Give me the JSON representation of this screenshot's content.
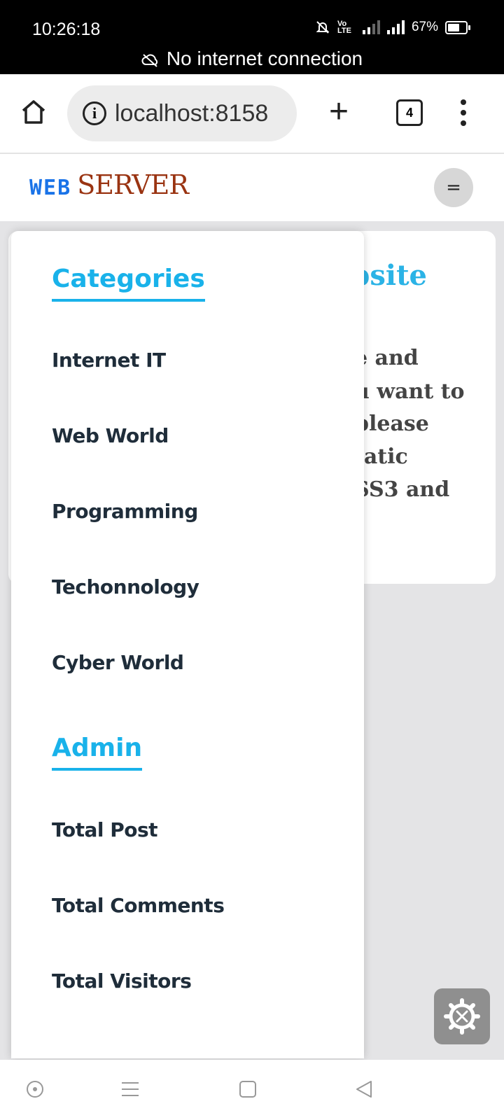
{
  "status_bar": {
    "time": "10:26:18",
    "battery": "67%",
    "volte": "Vo LTE",
    "notice": "No internet connection"
  },
  "browser": {
    "url": "localhost:8158",
    "tab_count": "4"
  },
  "site": {
    "logo_web": "WEB",
    "logo_server": "SERVER",
    "menu_icon": "="
  },
  "background_card": {
    "title_fragment": "bsite",
    "lines": [
      "e  and",
      "u  want  to",
      "please",
      "tatic",
      "SS3  and"
    ]
  },
  "drawer": {
    "categories_title": "Categories",
    "categories": [
      "Internet IT",
      "Web World",
      "Programming",
      "Techonnology",
      "Cyber World"
    ],
    "admin_title": "Admin",
    "admin_items": [
      "Total Post",
      "Total Comments",
      "Total Visitors"
    ]
  },
  "colors": {
    "accent": "#19b2ea",
    "logo_blue": "#1a73e8",
    "logo_brown": "#9a3412"
  }
}
